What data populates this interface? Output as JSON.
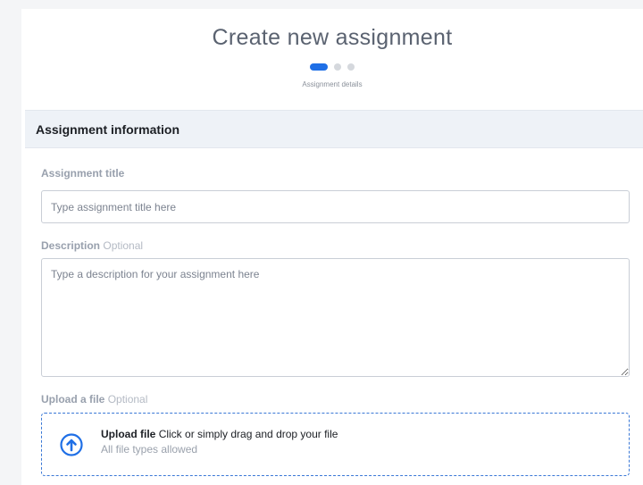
{
  "header": {
    "title": "Create new assignment",
    "step_caption": "Assignment details",
    "steps_total": 3,
    "active_step": 1
  },
  "section": {
    "title": "Assignment information"
  },
  "form": {
    "title_label": "Assignment title",
    "title_placeholder": "Type assignment title here",
    "title_value": "",
    "description_label": "Description",
    "description_optional": "Optional",
    "description_placeholder": "Type a description for your assignment here",
    "description_value": "",
    "upload_label": "Upload a file",
    "upload_optional": "Optional",
    "upload_action": "Upload file",
    "upload_instruction": "Click or simply drag and drop your file",
    "upload_note": "All file types allowed"
  },
  "colors": {
    "accent": "#1f6fe6",
    "dropzone_border": "#3a78d6",
    "label": "#98a0ad",
    "section_bg": "#eef2f7"
  },
  "icons": {
    "upload": "upload-arrow-circle-icon"
  }
}
